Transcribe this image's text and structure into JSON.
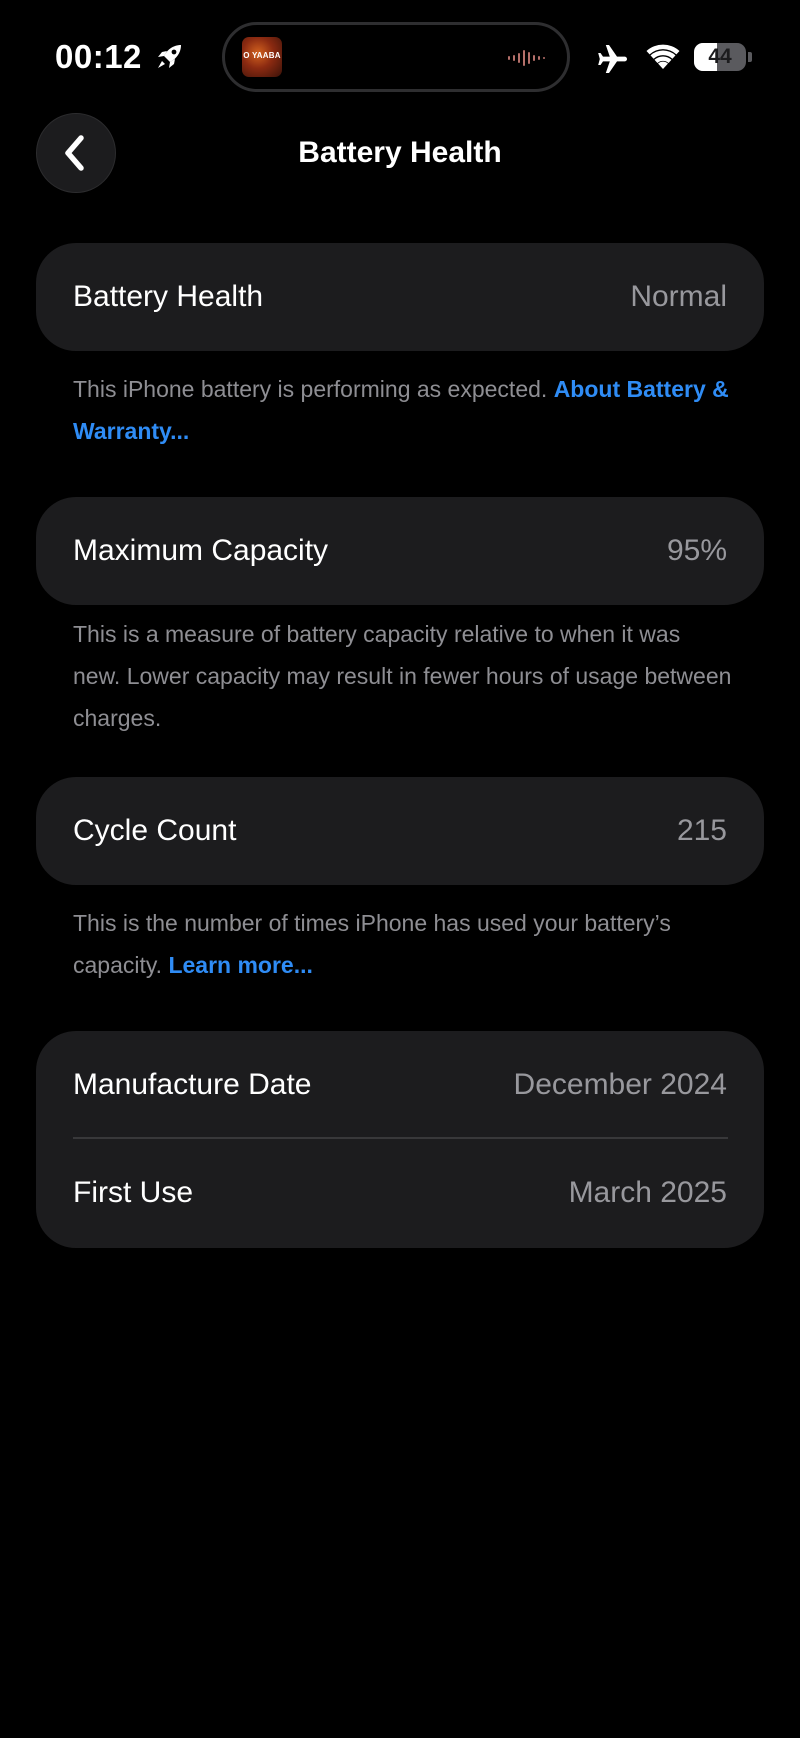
{
  "status_bar": {
    "time": "00:12",
    "album_text": "O YAABA",
    "battery_level": 44,
    "battery_label": "44"
  },
  "nav": {
    "title": "Battery Health"
  },
  "health": {
    "label": "Battery Health",
    "value": "Normal",
    "note": "This iPhone battery is performing as expected. ",
    "link": "About Battery & Warranty..."
  },
  "capacity": {
    "label": "Maximum Capacity",
    "value": "95%",
    "note": "This is a measure of battery capacity relative to when it was new. Lower capacity may result in fewer hours of usage between charges."
  },
  "cycles": {
    "label": "Cycle Count",
    "value": "215",
    "note": "This is the number of times iPhone has used your battery’s capacity. ",
    "link": "Learn more..."
  },
  "dates": {
    "manufacture_label": "Manufacture Date",
    "manufacture_value": "December 2024",
    "first_use_label": "First Use",
    "first_use_value": "March 2025"
  },
  "colors": {
    "background": "#000000",
    "card": "#1c1c1e",
    "secondary_text": "#98989d",
    "link": "#2f8cf5"
  }
}
